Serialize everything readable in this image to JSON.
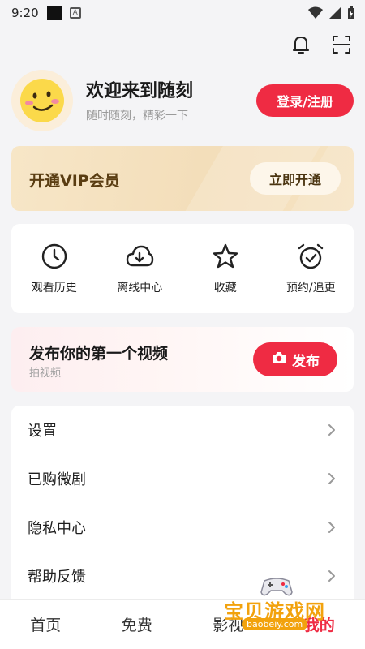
{
  "status_bar": {
    "time": "9:20",
    "a_icon": "A"
  },
  "header": {
    "notification_icon": "bell-icon",
    "scan_icon": "scan-icon"
  },
  "profile": {
    "welcome": "欢迎来到随刻",
    "subtitle": "随时随刻，精彩一下",
    "login_label": "登录/注册"
  },
  "vip": {
    "title": "开通VIP会员",
    "button": "立即开通"
  },
  "quick_actions": [
    {
      "label": "观看历史",
      "icon": "clock-icon"
    },
    {
      "label": "离线中心",
      "icon": "cloud-download-icon"
    },
    {
      "label": "收藏",
      "icon": "star-icon"
    },
    {
      "label": "预约/追更",
      "icon": "alarm-check-icon"
    }
  ],
  "publish": {
    "title": "发布你的第一个视频",
    "subtitle": "拍视频",
    "button": "发布"
  },
  "menu": [
    {
      "label": "设置"
    },
    {
      "label": "已购微剧"
    },
    {
      "label": "隐私中心"
    },
    {
      "label": "帮助反馈"
    }
  ],
  "bottom_nav": [
    {
      "label": "首页",
      "active": false
    },
    {
      "label": "免费",
      "active": false
    },
    {
      "label": "影视",
      "active": false
    },
    {
      "label": "我的",
      "active": true
    }
  ],
  "watermark": {
    "text": "宝贝游戏网",
    "url": "baobeiy.com"
  },
  "colors": {
    "accent": "#ef2b43",
    "vip_text": "#5a3d12",
    "background": "#f4f4f6"
  }
}
